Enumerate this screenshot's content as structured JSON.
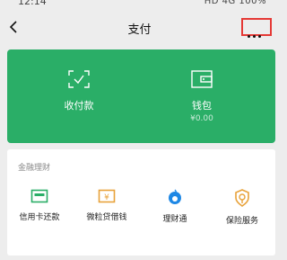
{
  "status": {
    "time": "12:14",
    "indicators": "HD 4G 100%"
  },
  "header": {
    "title": "支付",
    "back_icon": "chevron-left-icon",
    "more_icon": "more-dots-icon",
    "highlight_color": "#e53935"
  },
  "pay_card": {
    "color": "#2aae67",
    "items": [
      {
        "label": "收付款",
        "icon": "scan-check-icon"
      },
      {
        "label": "钱包",
        "sub": "¥0.00",
        "icon": "wallet-icon"
      }
    ]
  },
  "finance": {
    "title": "金融理财",
    "services": [
      {
        "label": "信用卡还款",
        "icon": "credit-card-icon",
        "color": "#2aae67"
      },
      {
        "label": "微粒贷借钱",
        "icon": "loan-icon",
        "color": "#e8a23a"
      },
      {
        "label": "理财通",
        "icon": "wealth-icon",
        "color": "#1e88e5"
      },
      {
        "label": "保险服务",
        "icon": "insurance-shield-icon",
        "color": "#e8a23a"
      }
    ]
  }
}
